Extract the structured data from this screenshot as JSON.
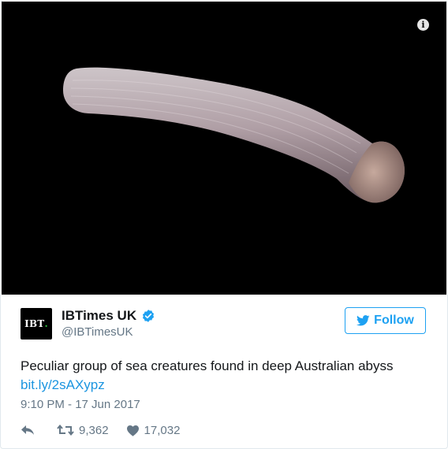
{
  "tweet": {
    "info_icon": "info-icon",
    "author": {
      "avatar_text": "IBT",
      "avatar_dot": ".",
      "name": "IBTimes UK",
      "handle": "@IBTimesUK",
      "verified_icon": "verified-badge-icon"
    },
    "follow_button": {
      "label": "Follow",
      "icon": "twitter-bird-icon"
    },
    "text": "Peculiar group of sea creatures found in deep Australian abyss",
    "link": "bit.ly/2sAXypz",
    "timestamp": "9:10 PM - 17 Jun 2017",
    "actions": {
      "reply_icon": "reply-icon",
      "retweet_icon": "retweet-icon",
      "retweet_count": "9,362",
      "like_icon": "heart-icon",
      "like_count": "17,032"
    },
    "colors": {
      "accent": "#1da1f2",
      "link": "#1b95e0",
      "muted": "#657786"
    }
  }
}
